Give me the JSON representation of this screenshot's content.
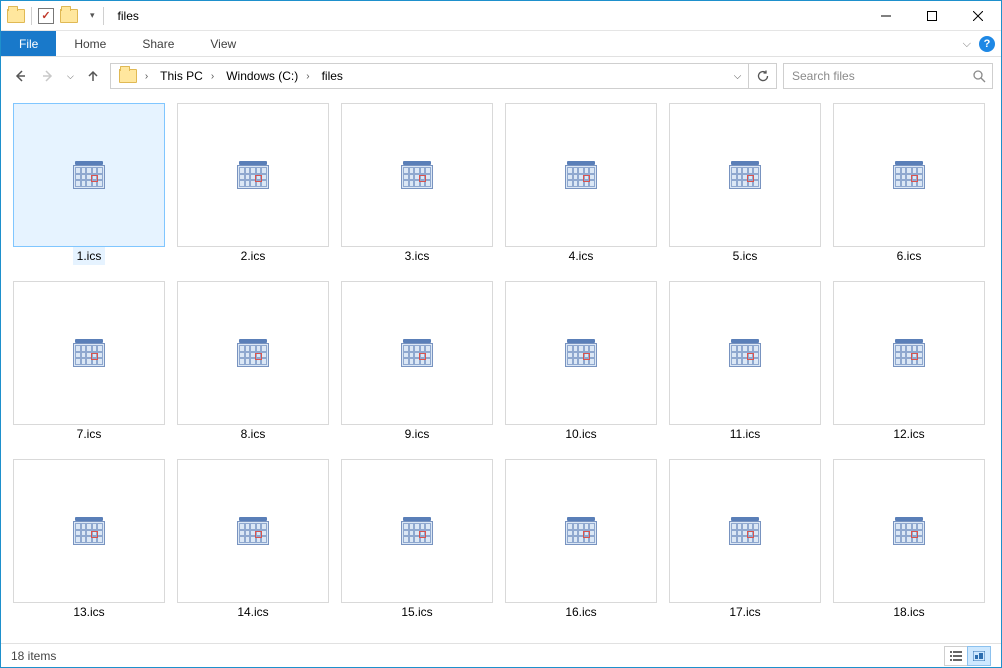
{
  "window": {
    "title": "files"
  },
  "ribbon": {
    "file": "File",
    "tabs": [
      "Home",
      "Share",
      "View"
    ]
  },
  "breadcrumb": {
    "segments": [
      "This PC",
      "Windows (C:)",
      "files"
    ]
  },
  "search": {
    "placeholder": "Search files"
  },
  "files": [
    {
      "name": "1.ics"
    },
    {
      "name": "2.ics"
    },
    {
      "name": "3.ics"
    },
    {
      "name": "4.ics"
    },
    {
      "name": "5.ics"
    },
    {
      "name": "6.ics"
    },
    {
      "name": "7.ics"
    },
    {
      "name": "8.ics"
    },
    {
      "name": "9.ics"
    },
    {
      "name": "10.ics"
    },
    {
      "name": "11.ics"
    },
    {
      "name": "12.ics"
    },
    {
      "name": "13.ics"
    },
    {
      "name": "14.ics"
    },
    {
      "name": "15.ics"
    },
    {
      "name": "16.ics"
    },
    {
      "name": "17.ics"
    },
    {
      "name": "18.ics"
    }
  ],
  "selected_index": 0,
  "status": {
    "item_count_label": "18 items"
  }
}
